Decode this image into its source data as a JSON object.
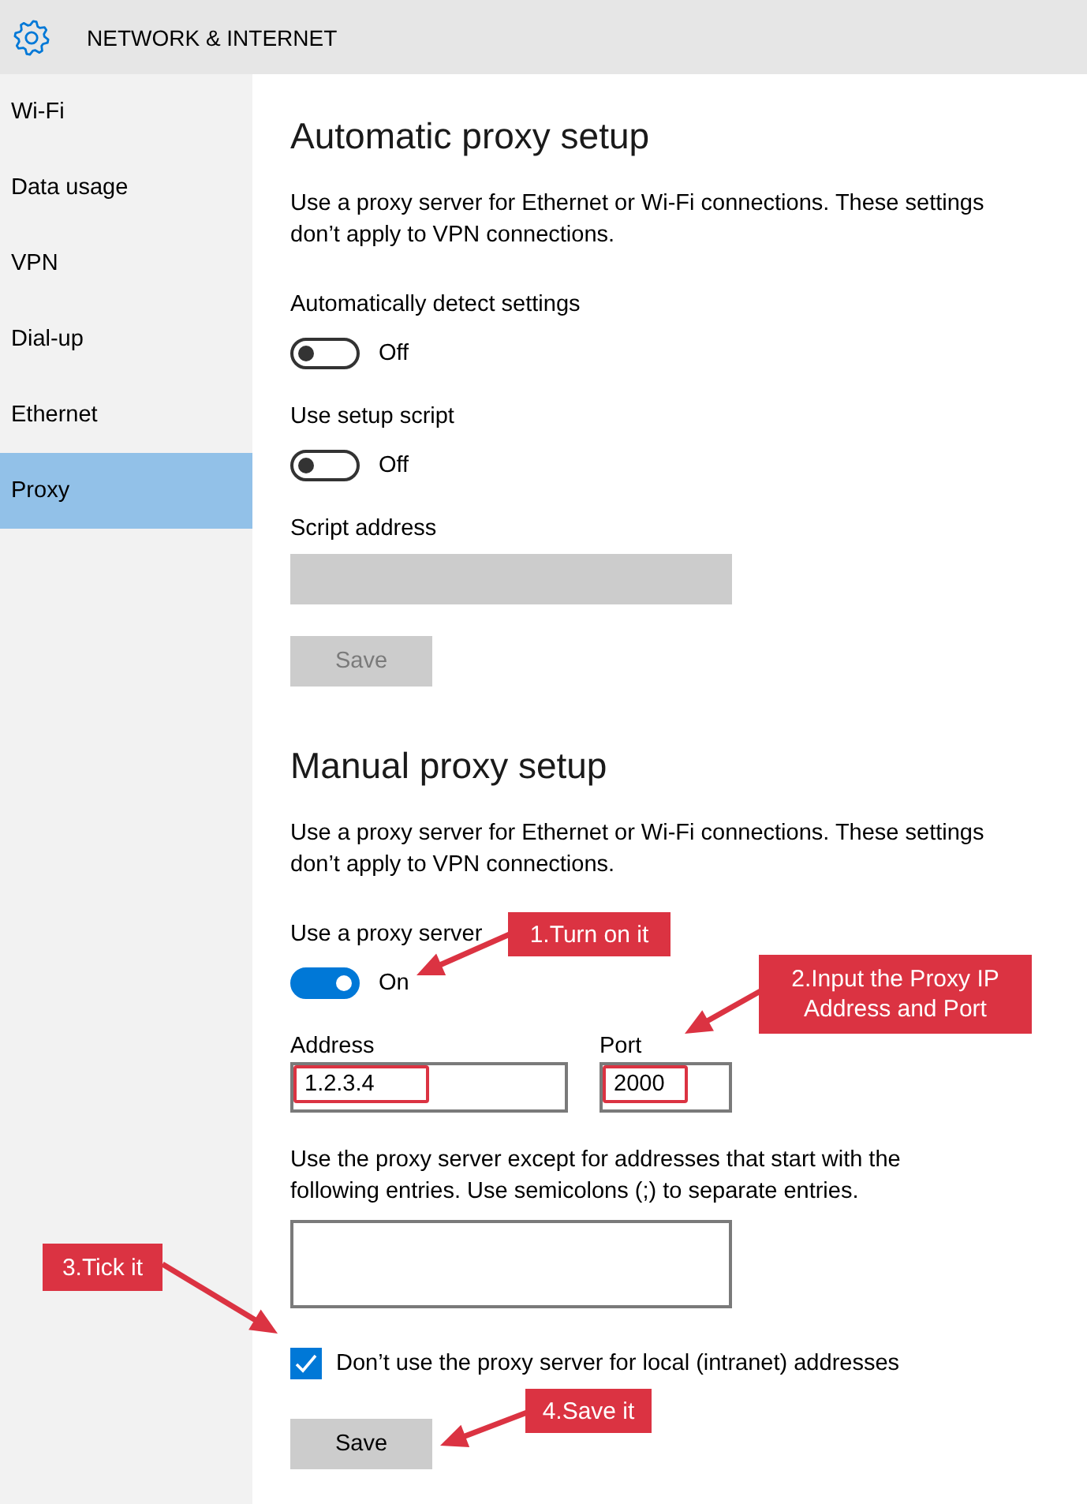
{
  "header": {
    "title": "NETWORK & INTERNET"
  },
  "sidebar": {
    "items": [
      {
        "label": "Wi-Fi",
        "selected": false
      },
      {
        "label": "Data usage",
        "selected": false
      },
      {
        "label": "VPN",
        "selected": false
      },
      {
        "label": "Dial-up",
        "selected": false
      },
      {
        "label": "Ethernet",
        "selected": false
      },
      {
        "label": "Proxy",
        "selected": true
      }
    ]
  },
  "sections": [
    {
      "title": "Automatic proxy setup",
      "description": "Use a proxy server for Ethernet or Wi-Fi connections. These settings don’t apply to VPN connections.",
      "controls": [
        {
          "kind": "toggle",
          "label": "Automatically detect settings",
          "on": false,
          "state_text": "Off"
        },
        {
          "kind": "toggle",
          "label": "Use setup script",
          "on": false,
          "state_text": "Off"
        },
        {
          "kind": "field",
          "label": "Script address",
          "disabled": true
        },
        {
          "kind": "button",
          "label": "Save",
          "disabled": true
        }
      ]
    },
    {
      "title": "Manual proxy setup",
      "description": "Use a proxy server for Ethernet or Wi-Fi connections. These settings don’t apply to VPN connections.",
      "controls": [
        {
          "kind": "toggle",
          "label": "Use a proxy server",
          "on": true,
          "state_text": "On"
        },
        {
          "kind": "field_pair",
          "fields": [
            {
              "label": "Address",
              "value": "1.2.3.4",
              "highlighted": true
            },
            {
              "label": "Port",
              "value": "2000",
              "highlighted": true
            }
          ]
        },
        {
          "kind": "textarea",
          "label": "Use the proxy server except for addresses that start with the following entries. Use semicolons (;) to separate entries.",
          "disabled": false
        },
        {
          "kind": "checkbox",
          "label": "Don’t use the proxy server for local (intranet) addresses",
          "checked": true
        },
        {
          "kind": "button",
          "label": "Save",
          "disabled": false
        }
      ]
    }
  ],
  "annotations": [
    {
      "text": "1.Turn on it"
    },
    {
      "text": "2.Input the Proxy IP\nAddress and Port"
    },
    {
      "text": "3.Tick it"
    },
    {
      "text": "4.Save it"
    }
  ]
}
